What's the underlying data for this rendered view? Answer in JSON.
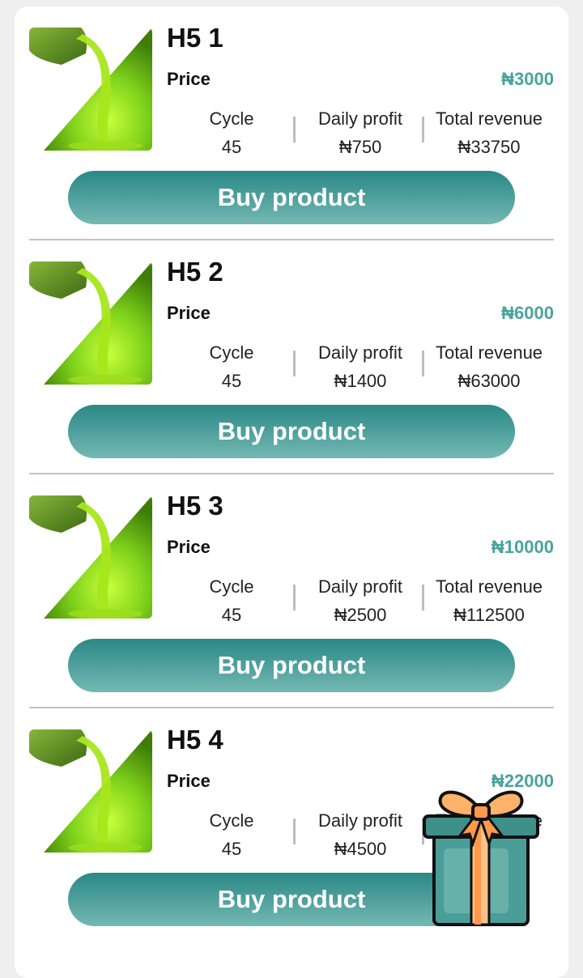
{
  "product_list": {
    "price_label": "Price",
    "stat_labels": {
      "cycle": "Cycle",
      "daily": "Daily profit",
      "total": "Total revenue"
    },
    "buy_label": "Buy product",
    "items": [
      {
        "name": "H5 1",
        "price": "₦3000",
        "cycle": "45",
        "daily": "₦750",
        "total": "₦33750"
      },
      {
        "name": "H5 2",
        "price": "₦6000",
        "cycle": "45",
        "daily": "₦1400",
        "total": "₦63000"
      },
      {
        "name": "H5 3",
        "price": "₦10000",
        "cycle": "45",
        "daily": "₦2500",
        "total": "₦112500"
      },
      {
        "name": "H5 4",
        "price": "₦22000",
        "cycle": "45",
        "daily": "₦4500",
        "total": ""
      }
    ]
  },
  "colors": {
    "accent": "#4aa39c",
    "button_top": "#2a8886",
    "button_bottom": "#74b8b3"
  },
  "icons": {
    "product_image": "oil-pour-icon",
    "floating": "gift-box-icon"
  }
}
